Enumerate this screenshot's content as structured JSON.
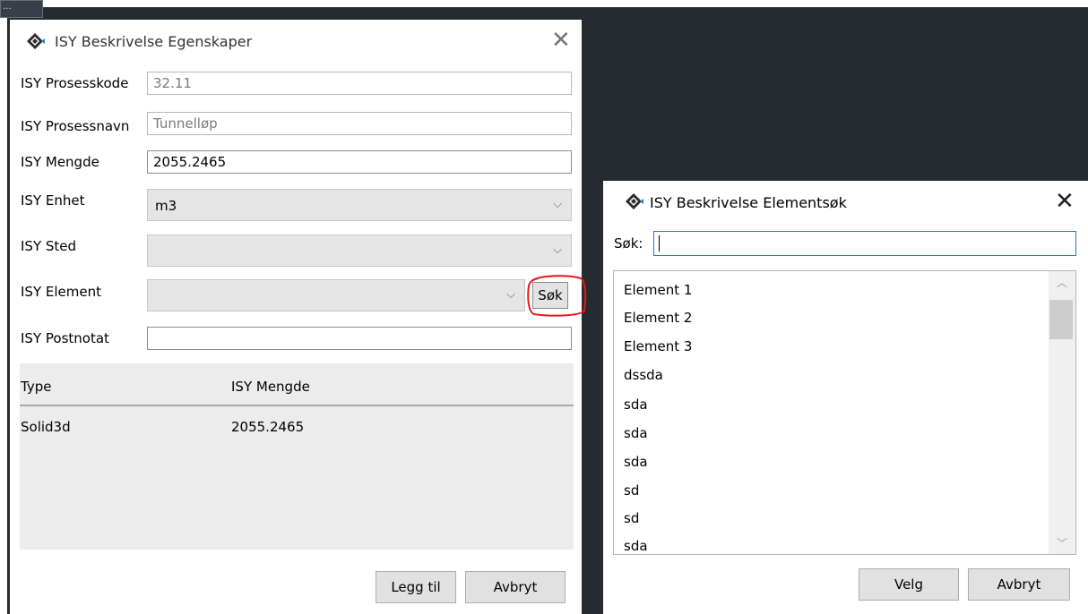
{
  "background": {
    "color": "#262a31",
    "corner_label": "..."
  },
  "dialog1": {
    "title": "ISY Beskrivelse Egenskaper",
    "close_icon": "close-icon",
    "fields": {
      "prosesskode": {
        "label": "ISY Prosesskode",
        "value": "32.11"
      },
      "prosessnavn": {
        "label": "ISY Prosessnavn",
        "value": "Tunnelløp"
      },
      "mengde": {
        "label": "ISY Mengde",
        "value": "2055.2465"
      },
      "enhet": {
        "label": "ISY Enhet",
        "value": "m3"
      },
      "sted": {
        "label": "ISY Sted",
        "value": ""
      },
      "element": {
        "label": "ISY Element",
        "value": ""
      },
      "postnotat": {
        "label": "ISY Postnotat",
        "value": ""
      }
    },
    "search_button": "Søk",
    "table": {
      "headers": [
        "Type",
        "ISY Mengde"
      ],
      "rows": [
        [
          "Solid3d",
          "2055.2465"
        ]
      ]
    },
    "add_button": "Legg til",
    "cancel_button": "Avbryt"
  },
  "dialog2": {
    "title": "ISY Beskrivelse Elementsøk",
    "close_icon": "close-icon",
    "search_label": "Søk:",
    "search_value": "",
    "items": [
      "Element 1",
      "Element 2",
      "Element 3",
      "dssda",
      "sda",
      "sda",
      "sda",
      "sd",
      "sd",
      "sda"
    ],
    "select_button": "Velg",
    "cancel_button": "Avbryt"
  },
  "annotation_color": "#e5191f"
}
